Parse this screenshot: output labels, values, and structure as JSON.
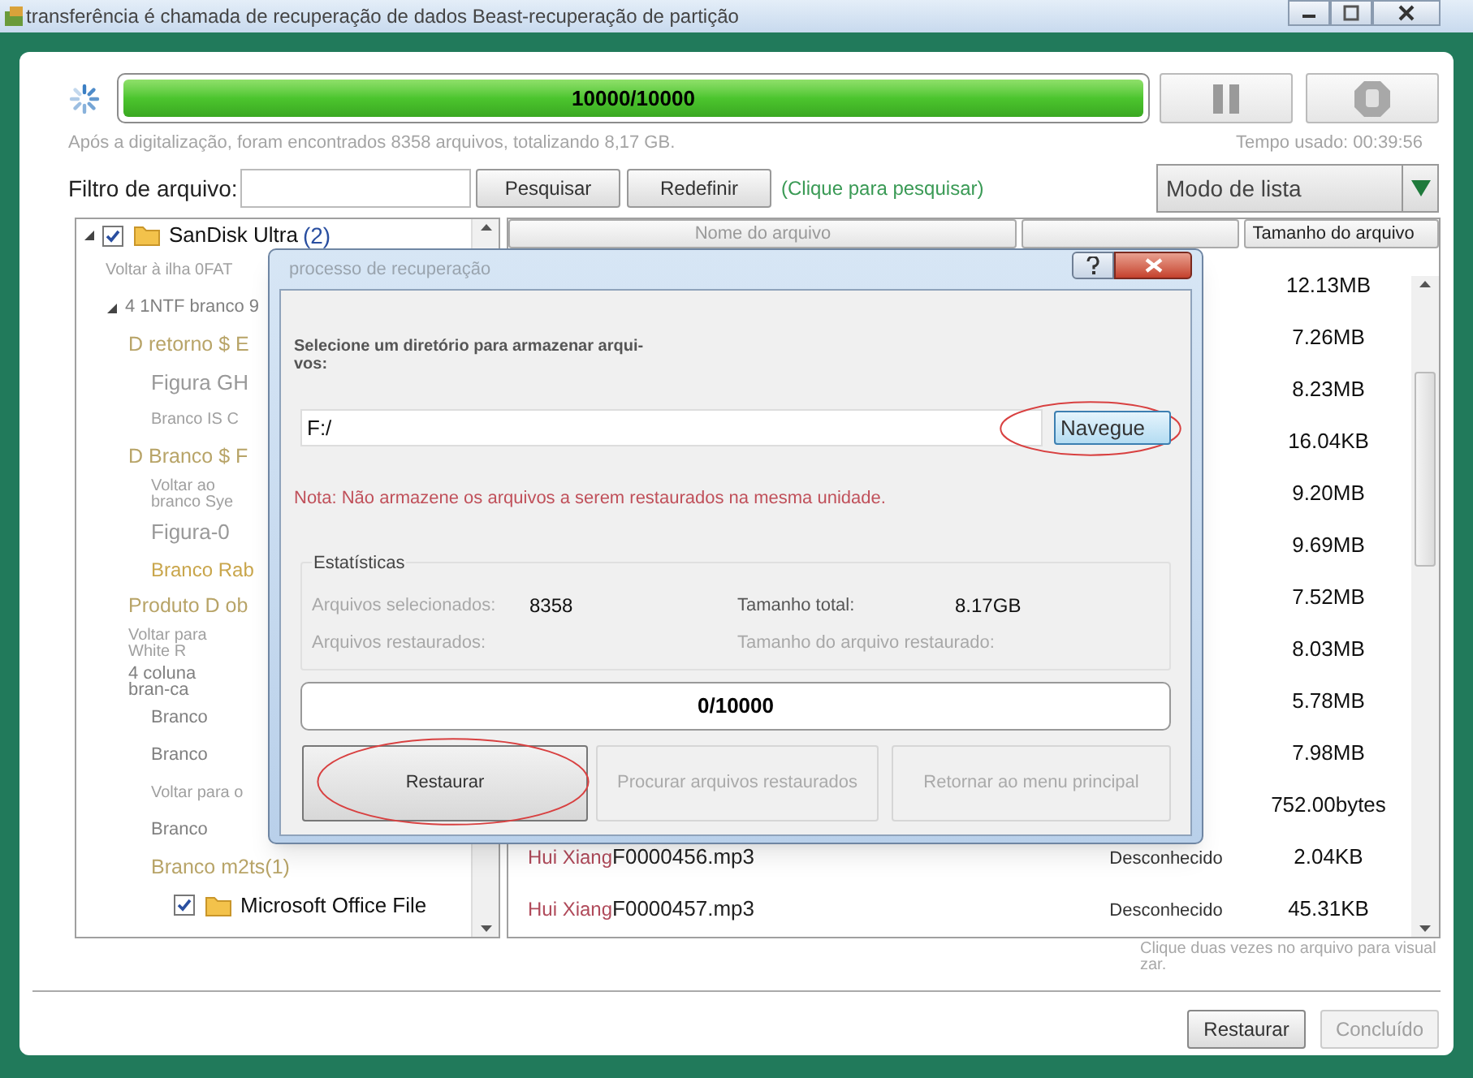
{
  "window": {
    "title": "transferência é chamada de recuperação de dados Beast-recuperação de partição"
  },
  "scan": {
    "progress_text": "10000/10000",
    "level": 1,
    "summary": "Após a digitalização, foram encontrados 8358 arquivos, totalizando 8,17 GB.",
    "time": "Tempo usado: 00:39:56"
  },
  "filter": {
    "label": "Filtro de arquivo:",
    "buttons": [
      "Pesquisar",
      "Redefinir"
    ],
    "hint": "(Clique para pesquisar)",
    "view_mode": "Modo de lista"
  },
  "tree": [
    {
      "kind": "folder",
      "label": "SanDisk Ultra",
      "count": "(2)",
      "checked": true,
      "expanded": true,
      "children": [
        {
          "kind": "link",
          "label": "Voltar à ilha 0FAT"
        },
        {
          "kind": "entry",
          "label": "4 1NTF branco 9",
          "expanded": true,
          "children": [
            {
              "kind": "heading",
              "label": "D retorno $ E",
              "children": [
                {
                  "kind": "figure",
                  "label": "Figura GH"
                },
                {
                  "kind": "link",
                  "label": "Branco IS C"
                }
              ]
            },
            {
              "kind": "heading",
              "label": "D Branco $ F",
              "children": [
                {
                  "kind": "link",
                  "label": "Voltar ao branco Sye"
                },
                {
                  "kind": "figure",
                  "label": "Figura-0"
                },
                {
                  "kind": "accent",
                  "label": "Branco Rab"
                }
              ]
            },
            {
              "kind": "heading",
              "label": "Produto D ob"
            },
            {
              "kind": "link",
              "label": "Voltar para White R"
            },
            {
              "kind": "entry",
              "label": "4 coluna bran-ca",
              "children": [
                {
                  "kind": "entry",
                  "label": "Branco"
                },
                {
                  "kind": "entry",
                  "label": "Branco"
                },
                {
                  "kind": "link",
                  "label": "Voltar para o"
                },
                {
                  "kind": "entry",
                  "label": "Branco"
                },
                {
                  "kind": "heading",
                  "label": "Branco m2ts(1)",
                  "children": [
                    {
                      "kind": "folder",
                      "label": "Microsoft Office File",
                      "checked": true
                    }
                  ]
                }
              ]
            }
          ]
        }
      ]
    }
  ],
  "list": {
    "columns": {
      "name": "Nome do arquivo",
      "size": "Tamanho do arquivo"
    },
    "rows": [
      {
        "size": "12.13MB"
      },
      {
        "size": "7.26MB"
      },
      {
        "size": "8.23MB"
      },
      {
        "size": "16.04KB"
      },
      {
        "size": "9.20MB"
      },
      {
        "size": "9.69MB"
      },
      {
        "size": "7.52MB"
      },
      {
        "size": "8.03MB"
      },
      {
        "size": "5.78MB"
      },
      {
        "size": "7.98MB"
      },
      {
        "size": "752.00bytes"
      },
      {
        "artist": "Hui Xiang",
        "name": "F0000456.mp3",
        "type": "Desconhecido",
        "size": "2.04KB"
      },
      {
        "artist": "Hui Xiang",
        "name": "F0000457.mp3",
        "type": "Desconhecido",
        "size": "45.31KB"
      }
    ],
    "hint_lines": [
      "Clique duas vezes no arquivo para visual",
      "zar."
    ]
  },
  "footer_buttons": [
    {
      "label": "Restaurar",
      "disabled": false
    },
    {
      "label": "Concluído",
      "disabled": true
    }
  ],
  "dialog": {
    "title": "processo de recuperação",
    "prompt_lines": [
      "Selecione um diretório para armazenar arqui-",
      "vos:"
    ],
    "path": "F:/",
    "browse": {
      "label": "Navegue",
      "highlighted": true
    },
    "note": "Nota: Não armazene os arquivos a serem restaurados na mesma unidade.",
    "stats": {
      "title": "Estatísticas",
      "items": [
        {
          "label": "Arquivos selecionados:",
          "value": "8358"
        },
        {
          "label": "Tamanho total:",
          "value": "8.17GB"
        },
        {
          "label": "Arquivos restaurados:"
        },
        {
          "label": "Tamanho do arquivo restaurado:"
        }
      ]
    },
    "progress": {
      "text": "0/10000",
      "level": 0
    },
    "buttons": [
      {
        "label": "Restaurar",
        "disabled": false,
        "highlighted": true
      },
      {
        "label": "Procurar arquivos restaurados",
        "disabled": true,
        "highlighted": false
      },
      {
        "label": "Retornar ao menu principal",
        "disabled": true,
        "highlighted": false
      }
    ]
  }
}
